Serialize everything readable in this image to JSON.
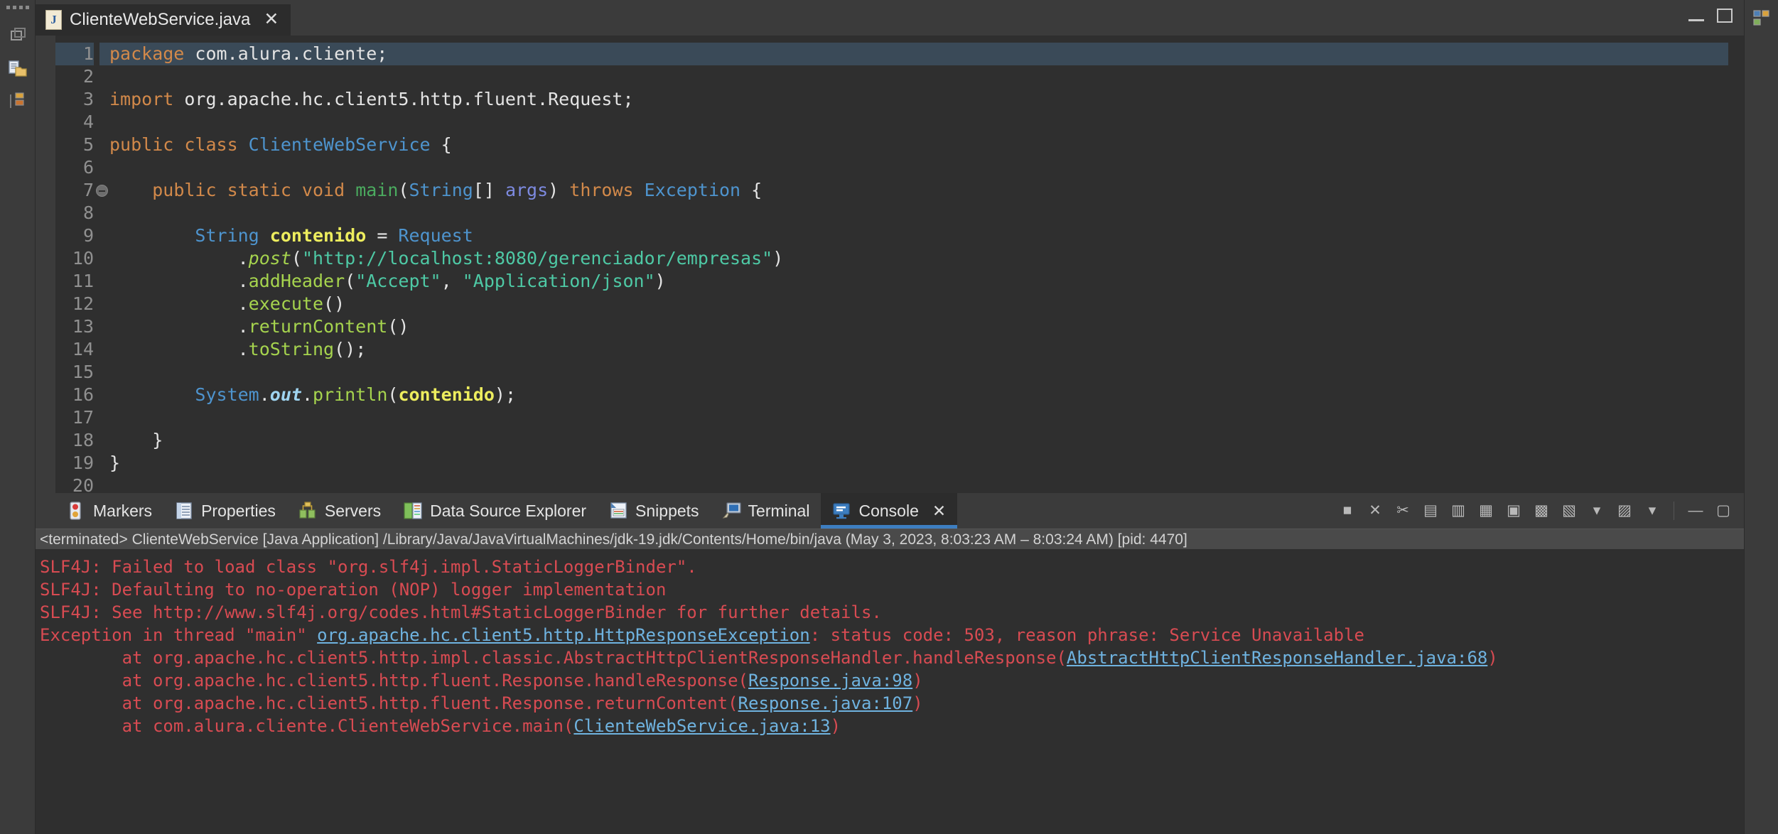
{
  "window": {
    "minimize_label": "—",
    "maximize_label": "▢"
  },
  "editor_tab": {
    "filename": "ClienteWebService.java",
    "file_icon_letter": "J",
    "close_label": "✕"
  },
  "editor": {
    "current_line": 1,
    "lines": [
      {
        "n": "1",
        "tokens": [
          {
            "t": "package ",
            "c": "kw"
          },
          {
            "t": "com.alura.cliente;",
            "c": "plain"
          }
        ]
      },
      {
        "n": "2",
        "tokens": []
      },
      {
        "n": "3",
        "tokens": [
          {
            "t": "import ",
            "c": "kw"
          },
          {
            "t": "org.apache.hc.client5.http.fluent.Request;",
            "c": "plain"
          }
        ]
      },
      {
        "n": "4",
        "tokens": []
      },
      {
        "n": "5",
        "tokens": [
          {
            "t": "public class ",
            "c": "kw"
          },
          {
            "t": "ClienteWebService",
            "c": "type"
          },
          {
            "t": " {",
            "c": "plain"
          }
        ]
      },
      {
        "n": "6",
        "tokens": []
      },
      {
        "n": "7",
        "fold": true,
        "tokens": [
          {
            "t": "    ",
            "c": "plain"
          },
          {
            "t": "public static void ",
            "c": "kw"
          },
          {
            "t": "main",
            "c": "mname"
          },
          {
            "t": "(",
            "c": "plain"
          },
          {
            "t": "String",
            "c": "type"
          },
          {
            "t": "[] ",
            "c": "plain"
          },
          {
            "t": "args",
            "c": "pvar"
          },
          {
            "t": ") ",
            "c": "plain"
          },
          {
            "t": "throws ",
            "c": "kw"
          },
          {
            "t": "Exception",
            "c": "type"
          },
          {
            "t": " {",
            "c": "plain"
          }
        ]
      },
      {
        "n": "8",
        "tokens": []
      },
      {
        "n": "9",
        "tokens": [
          {
            "t": "        ",
            "c": "plain"
          },
          {
            "t": "String",
            "c": "type"
          },
          {
            "t": " ",
            "c": "plain"
          },
          {
            "t": "contenido",
            "c": "var"
          },
          {
            "t": " = ",
            "c": "plain"
          },
          {
            "t": "Request",
            "c": "type"
          }
        ]
      },
      {
        "n": "10",
        "tokens": [
          {
            "t": "            .",
            "c": "plain"
          },
          {
            "t": "post",
            "c": "meths"
          },
          {
            "t": "(",
            "c": "plain"
          },
          {
            "t": "\"http://localhost:8080/gerenciador/empresas\"",
            "c": "str"
          },
          {
            "t": ")",
            "c": "plain"
          }
        ]
      },
      {
        "n": "11",
        "tokens": [
          {
            "t": "            .",
            "c": "plain"
          },
          {
            "t": "addHeader",
            "c": "meth"
          },
          {
            "t": "(",
            "c": "plain"
          },
          {
            "t": "\"Accept\"",
            "c": "str"
          },
          {
            "t": ", ",
            "c": "plain"
          },
          {
            "t": "\"Application/json\"",
            "c": "str"
          },
          {
            "t": ")",
            "c": "plain"
          }
        ]
      },
      {
        "n": "12",
        "tokens": [
          {
            "t": "            .",
            "c": "plain"
          },
          {
            "t": "execute",
            "c": "meth"
          },
          {
            "t": "()",
            "c": "plain"
          }
        ]
      },
      {
        "n": "13",
        "tokens": [
          {
            "t": "            .",
            "c": "plain"
          },
          {
            "t": "returnContent",
            "c": "meth"
          },
          {
            "t": "()",
            "c": "plain"
          }
        ]
      },
      {
        "n": "14",
        "tokens": [
          {
            "t": "            .",
            "c": "plain"
          },
          {
            "t": "toString",
            "c": "meth"
          },
          {
            "t": "();",
            "c": "plain"
          }
        ]
      },
      {
        "n": "15",
        "tokens": []
      },
      {
        "n": "16",
        "tokens": [
          {
            "t": "        ",
            "c": "plain"
          },
          {
            "t": "System",
            "c": "type"
          },
          {
            "t": ".",
            "c": "plain"
          },
          {
            "t": "out",
            "c": "fld"
          },
          {
            "t": ".",
            "c": "plain"
          },
          {
            "t": "println",
            "c": "meth"
          },
          {
            "t": "(",
            "c": "plain"
          },
          {
            "t": "contenido",
            "c": "var"
          },
          {
            "t": ");",
            "c": "plain"
          }
        ]
      },
      {
        "n": "17",
        "tokens": []
      },
      {
        "n": "18",
        "tokens": [
          {
            "t": "    }",
            "c": "plain"
          }
        ]
      },
      {
        "n": "19",
        "tokens": [
          {
            "t": "}",
            "c": "plain"
          }
        ]
      },
      {
        "n": "20",
        "tokens": []
      }
    ]
  },
  "bottom_tabs": [
    {
      "label": "Markers",
      "icon": "markers-icon",
      "active": false,
      "closable": false
    },
    {
      "label": "Properties",
      "icon": "properties-icon",
      "active": false,
      "closable": false
    },
    {
      "label": "Servers",
      "icon": "servers-icon",
      "active": false,
      "closable": false
    },
    {
      "label": "Data Source Explorer",
      "icon": "data-source-explorer-icon",
      "active": false,
      "closable": false
    },
    {
      "label": "Snippets",
      "icon": "snippets-icon",
      "active": false,
      "closable": false
    },
    {
      "label": "Terminal",
      "icon": "terminal-icon",
      "active": false,
      "closable": false
    },
    {
      "label": "Console",
      "icon": "console-icon",
      "active": true,
      "closable": true,
      "close_label": "✕"
    }
  ],
  "console_toolbar": [
    {
      "name": "terminate-button",
      "glyph": "■"
    },
    {
      "name": "remove-launch-button",
      "glyph": "✕"
    },
    {
      "name": "remove-all-terminated-button",
      "glyph": "✂"
    },
    {
      "name": "clear-console-button",
      "glyph": "▤"
    },
    {
      "name": "scroll-lock-button",
      "glyph": "▥"
    },
    {
      "name": "word-wrap-button",
      "glyph": "▦"
    },
    {
      "name": "pin-console-button",
      "glyph": "▣"
    },
    {
      "name": "display-selected-console-button",
      "glyph": "▩"
    },
    {
      "name": "open-console-button",
      "glyph": "▧"
    },
    {
      "name": "open-console-dropdown",
      "glyph": "▾"
    },
    {
      "name": "new-console-view-button",
      "glyph": "▨"
    },
    {
      "name": "new-console-dropdown",
      "glyph": "▾"
    },
    {
      "name": "minimize-panel-button",
      "glyph": "—"
    },
    {
      "name": "maximize-panel-button",
      "glyph": "▢"
    }
  ],
  "console": {
    "status_line": "<terminated> ClienteWebService [Java Application] /Library/Java/JavaVirtualMachines/jdk-19.jdk/Contents/Home/bin/java  (May 3, 2023, 8:03:23 AM – 8:03:24 AM) [pid: 4470]",
    "lines": [
      {
        "segments": [
          {
            "t": "SLF4J: Failed to load class \"org.slf4j.impl.StaticLoggerBinder\".",
            "link": false
          }
        ]
      },
      {
        "segments": [
          {
            "t": "SLF4J: Defaulting to no-operation (NOP) logger implementation",
            "link": false
          }
        ]
      },
      {
        "segments": [
          {
            "t": "SLF4J: See http://www.slf4j.org/codes.html#StaticLoggerBinder for further details.",
            "link": false
          }
        ]
      },
      {
        "segments": [
          {
            "t": "Exception in thread \"main\" ",
            "link": false
          },
          {
            "t": "org.apache.hc.client5.http.HttpResponseException",
            "link": true
          },
          {
            "t": ": status code: 503, reason phrase: Service Unavailable",
            "link": false
          }
        ]
      },
      {
        "segments": [
          {
            "t": "\tat org.apache.hc.client5.http.impl.classic.AbstractHttpClientResponseHandler.handleResponse(",
            "link": false
          },
          {
            "t": "AbstractHttpClientResponseHandler.java:68",
            "link": true
          },
          {
            "t": ")",
            "link": false
          }
        ]
      },
      {
        "segments": [
          {
            "t": "\tat org.apache.hc.client5.http.fluent.Response.handleResponse(",
            "link": false
          },
          {
            "t": "Response.java:98",
            "link": true
          },
          {
            "t": ")",
            "link": false
          }
        ]
      },
      {
        "segments": [
          {
            "t": "\tat org.apache.hc.client5.http.fluent.Response.returnContent(",
            "link": false
          },
          {
            "t": "Response.java:107",
            "link": true
          },
          {
            "t": ")",
            "link": false
          }
        ]
      },
      {
        "segments": [
          {
            "t": "\tat com.alura.cliente.ClienteWebService.main(",
            "link": false
          },
          {
            "t": "ClienteWebService.java:13",
            "link": true
          },
          {
            "t": ")",
            "link": false
          }
        ]
      }
    ]
  },
  "colors": {
    "editor_background": "#2f2f2f",
    "chrome_background": "#3b3b3b",
    "active_tab_background": "#2c2c2c",
    "console_error": "#d84b52",
    "console_link": "#6fb3e0",
    "accent_blue": "#3d7ec0",
    "current_line_highlight": "#3a4a58"
  }
}
